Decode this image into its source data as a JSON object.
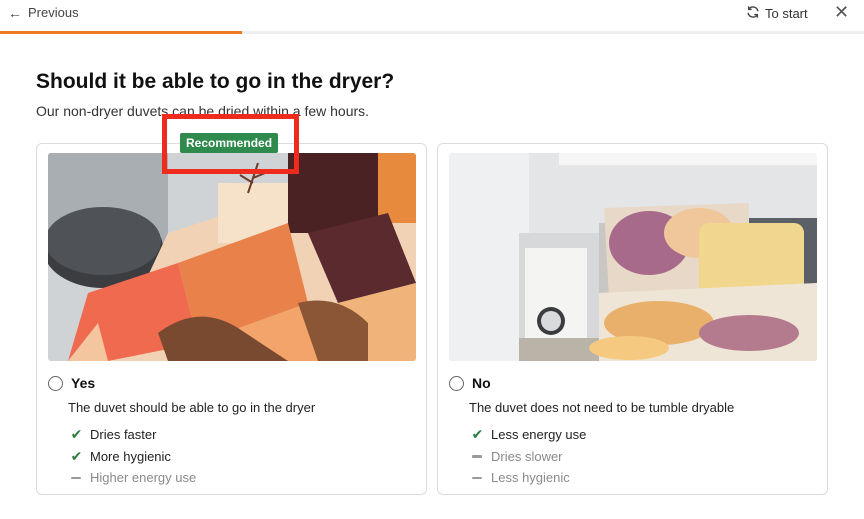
{
  "topbar": {
    "previous_label": "Previous",
    "to_start_label": "To start",
    "progress_fraction": 0.28,
    "accent_color": "#f07a22"
  },
  "question": {
    "title": "Should it be able to go in the dryer?",
    "subtitle": "Our non-dryer duvets can be dried within a few hours."
  },
  "badge": {
    "label": "Recommended",
    "color": "#2f8a4e"
  },
  "options": [
    {
      "label": "Yes",
      "description": "The duvet should be able to go in the dryer",
      "selected": false,
      "features": [
        {
          "text": "Dries faster",
          "type": "pro"
        },
        {
          "text": "More hygienic",
          "type": "pro"
        },
        {
          "text": "Higher energy use",
          "type": "con"
        }
      ]
    },
    {
      "label": "No",
      "description": "The duvet does not need to be tumble dryable",
      "selected": false,
      "features": [
        {
          "text": "Less energy use",
          "type": "pro"
        },
        {
          "text": "Dries slower",
          "type": "con"
        },
        {
          "text": "Less hygienic",
          "type": "con"
        }
      ]
    }
  ],
  "icons": {
    "back": "arrow-left-icon",
    "restart": "refresh-icon",
    "close": "close-icon",
    "pro": "check-icon",
    "con": "dash-icon"
  }
}
